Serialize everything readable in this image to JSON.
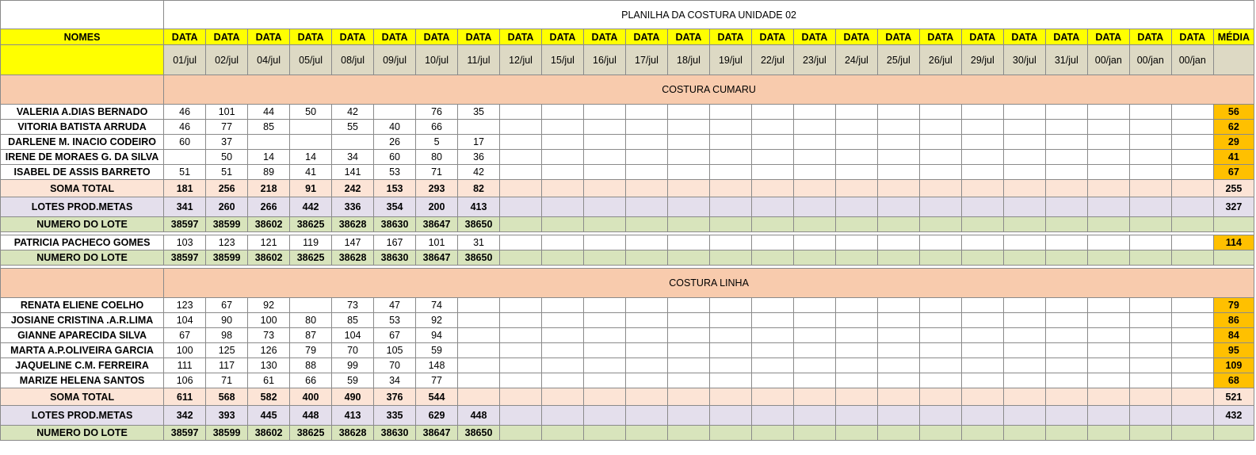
{
  "title": "PLANILHA DA COSTURA UNIDADE 02",
  "header": {
    "nomes_label": "NOMES",
    "data_label": "DATA",
    "media_label": "MÉDIA",
    "dates": [
      "01/jul",
      "02/jul",
      "04/jul",
      "05/jul",
      "08/jul",
      "09/jul",
      "10/jul",
      "11/jul",
      "12/jul",
      "15/jul",
      "16/jul",
      "17/jul",
      "18/jul",
      "19/jul",
      "22/jul",
      "23/jul",
      "24/jul",
      "25/jul",
      "26/jul",
      "29/jul",
      "30/jul",
      "31/jul",
      "00/jan",
      "00/jan",
      "00/jan"
    ]
  },
  "blocks": [
    {
      "kind": "section",
      "title": "COSTURA CUMARU"
    },
    {
      "kind": "person",
      "name": "VALERIA A.DIAS BERNADO",
      "values": [
        "46",
        "101",
        "44",
        "50",
        "42",
        "",
        "76",
        "35"
      ],
      "media": "56"
    },
    {
      "kind": "person",
      "name": "VITORIA BATISTA ARRUDA",
      "values": [
        "46",
        "77",
        "85",
        "",
        "55",
        "40",
        "66",
        ""
      ],
      "media": "62"
    },
    {
      "kind": "person",
      "name": "DARLENE M. INACIO CODEIRO",
      "values": [
        "60",
        "37",
        "",
        "",
        "",
        "26",
        "5",
        "17"
      ],
      "media": "29"
    },
    {
      "kind": "person",
      "name": "IRENE DE MORAES G. DA SILVA",
      "values": [
        "",
        "50",
        "14",
        "14",
        "34",
        "60",
        "80",
        "36"
      ],
      "media": "41"
    },
    {
      "kind": "person",
      "name": "ISABEL DE ASSIS BARRETO",
      "values": [
        "51",
        "51",
        "89",
        "41",
        "141",
        "53",
        "71",
        "42"
      ],
      "media": "67"
    },
    {
      "kind": "soma",
      "name": "SOMA TOTAL",
      "values": [
        "181",
        "256",
        "218",
        "91",
        "242",
        "153",
        "293",
        "82"
      ],
      "media": "255"
    },
    {
      "kind": "lotes",
      "name": "LOTES PROD.METAS",
      "values": [
        "341",
        "260",
        "266",
        "442",
        "336",
        "354",
        "200",
        "413"
      ],
      "media": "327"
    },
    {
      "kind": "numero",
      "name": "NUMERO DO LOTE",
      "values": [
        "38597",
        "38599",
        "38602",
        "38625",
        "38628",
        "38630",
        "38647",
        "38650"
      ],
      "media": ""
    },
    {
      "kind": "sep"
    },
    {
      "kind": "person",
      "name": "PATRICIA PACHECO GOMES",
      "values": [
        "103",
        "123",
        "121",
        "119",
        "147",
        "167",
        "101",
        "31"
      ],
      "media": "114"
    },
    {
      "kind": "numero",
      "name": "NUMERO DO LOTE",
      "values": [
        "38597",
        "38599",
        "38602",
        "38625",
        "38628",
        "38630",
        "38647",
        "38650"
      ],
      "media": ""
    },
    {
      "kind": "sep"
    },
    {
      "kind": "section",
      "title": "COSTURA LINHA"
    },
    {
      "kind": "person",
      "name": "RENATA ELIENE COELHO",
      "values": [
        "123",
        "67",
        "92",
        "",
        "73",
        "47",
        "74",
        ""
      ],
      "media": "79"
    },
    {
      "kind": "person",
      "name": "JOSIANE CRISTINA .A.R.LIMA",
      "values": [
        "104",
        "90",
        "100",
        "80",
        "85",
        "53",
        "92",
        ""
      ],
      "media": "86"
    },
    {
      "kind": "person",
      "name": "GIANNE APARECIDA SILVA",
      "values": [
        "67",
        "98",
        "73",
        "87",
        "104",
        "67",
        "94",
        ""
      ],
      "media": "84"
    },
    {
      "kind": "person",
      "name": "MARTA A.P.OLIVEIRA GARCIA",
      "values": [
        "100",
        "125",
        "126",
        "79",
        "70",
        "105",
        "59",
        ""
      ],
      "media": "95"
    },
    {
      "kind": "person",
      "name": "JAQUELINE C.M. FERREIRA",
      "values": [
        "111",
        "117",
        "130",
        "88",
        "99",
        "70",
        "148",
        ""
      ],
      "media": "109"
    },
    {
      "kind": "person",
      "name": "MARIZE HELENA SANTOS",
      "values": [
        "106",
        "71",
        "61",
        "66",
        "59",
        "34",
        "77",
        ""
      ],
      "media": "68"
    },
    {
      "kind": "soma",
      "name": "SOMA TOTAL",
      "values": [
        "611",
        "568",
        "582",
        "400",
        "490",
        "376",
        "544",
        ""
      ],
      "media": "521"
    },
    {
      "kind": "lotes",
      "name": "LOTES PROD.METAS",
      "values": [
        "342",
        "393",
        "445",
        "448",
        "413",
        "335",
        "629",
        "448"
      ],
      "media": "432"
    },
    {
      "kind": "numero",
      "name": "NUMERO DO LOTE",
      "values": [
        "38597",
        "38599",
        "38602",
        "38625",
        "38628",
        "38630",
        "38647",
        "38650"
      ],
      "media": ""
    }
  ]
}
